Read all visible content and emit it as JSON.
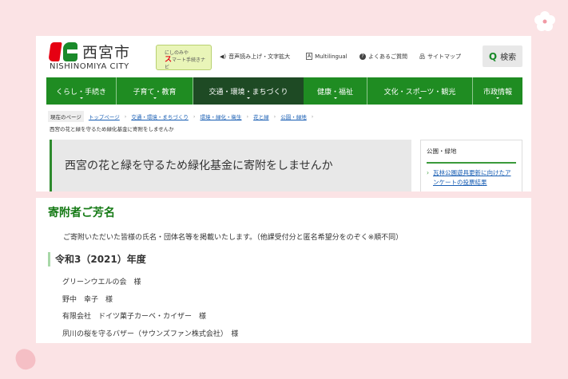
{
  "header": {
    "logo_jp": "西宮市",
    "logo_en": "NISHINOMIYA CITY",
    "smart_line1": "にしのみや",
    "smart_s": "ス",
    "smart_line2": "マート手続きナビ",
    "tools": [
      {
        "icon": "speaker-icon",
        "label": "音声読み上げ・文字拡大"
      },
      {
        "icon": "multilingual-icon",
        "label": "Multilingual"
      },
      {
        "icon": "question-icon",
        "label": "よくあるご質問"
      },
      {
        "icon": "sitemap-icon",
        "label": "サイトマップ"
      }
    ],
    "search_label": "検索"
  },
  "nav": [
    "くらし・手続き",
    "子育て・教育",
    "交通・環境・まちづくり",
    "健康・福祉",
    "文化・スポーツ・観光",
    "市政情報"
  ],
  "breadcrumb": {
    "current_label": "現在のページ",
    "links": [
      "トップページ",
      "交通・環境・まちづくり",
      "環境・緑化・衛生",
      "花と緑",
      "公園・緑地"
    ],
    "page": "西宮の花と緑を守るため緑化基金に寄附をしませんか"
  },
  "title": "西宮の花と緑を守るため緑化基金に寄附をしませんか",
  "sidebar": {
    "heading": "公園・緑地",
    "link": "瓦林公園遊具更新に向けたアンケートの投票結果"
  },
  "content": {
    "heading": "寄附者ご芳名",
    "intro": "ご寄附いただいた皆様の氏名・団体名等を掲載いたします。（他課受付分と匿名希望分をのぞく※順不同）",
    "year": "令和3（2021）年度",
    "donors": [
      "グリーンウエルの会　様",
      "野中　幸子　様",
      "有限会社　ドイツ菓子カーベ・カイザー　様",
      "夙川の桜を守るバザー（サウンズファン株式会社）　様"
    ]
  },
  "colors": {
    "green": "#1f8c22",
    "active_nav": "#1e4a24",
    "bg": "#fbe3e5"
  }
}
